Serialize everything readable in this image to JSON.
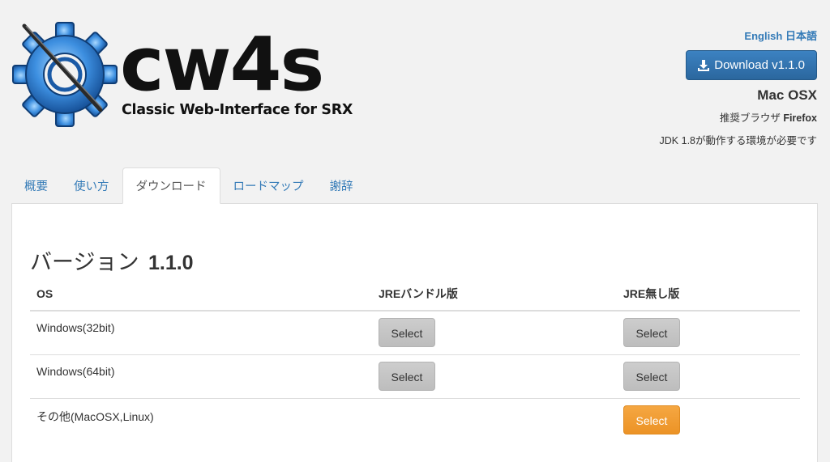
{
  "logo": {
    "text": "cw4s",
    "caption": "Classic Web-Interface for SRX"
  },
  "header": {
    "lang_english": "English",
    "lang_japanese": "日本語",
    "download_label": "Download v1.1.0",
    "os_name": "Mac OSX",
    "recommend_prefix": "推奨ブラウザ ",
    "recommend_browser": "Firefox",
    "jdk_note": "JDK 1.8が動作する環境が必要です"
  },
  "tabs": [
    {
      "label": "概要",
      "active": false
    },
    {
      "label": "使い方",
      "active": false
    },
    {
      "label": "ダウンロード",
      "active": true
    },
    {
      "label": "ロードマップ",
      "active": false
    },
    {
      "label": "謝辞",
      "active": false
    }
  ],
  "main": {
    "heading_prefix": "バージョン",
    "heading_version": "1.1.0",
    "columns": [
      "OS",
      "JREバンドル版",
      "JRE無し版"
    ],
    "rows": [
      {
        "os": "Windows(32bit)",
        "bundled": "Select",
        "nojre": "Select"
      },
      {
        "os": "Windows(64bit)",
        "bundled": "Select",
        "nojre": "Select"
      },
      {
        "os": "その他(MacOSX,Linux)",
        "bundled": "",
        "nojre": "Select"
      }
    ]
  },
  "colors": {
    "link": "#337ab7",
    "primary_button": "#2e6da4",
    "highlight_button": "#f0a030",
    "default_button": "#c4c4c4"
  }
}
